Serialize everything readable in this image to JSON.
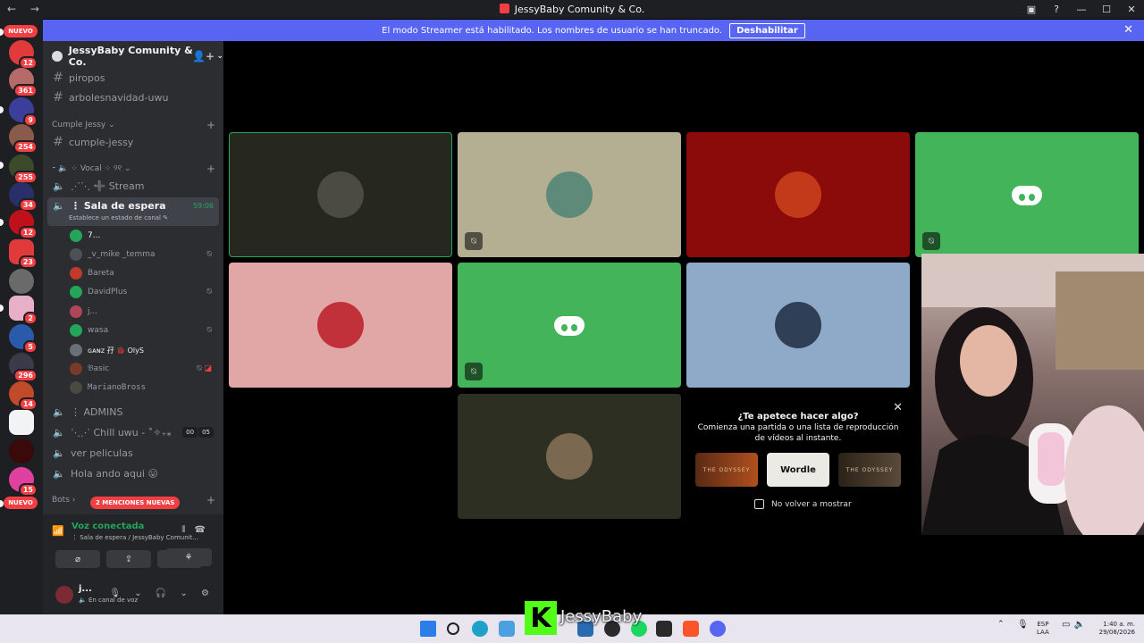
{
  "window": {
    "title": "JessyBaby Comunity & Co.",
    "nav": "← →",
    "buttons": [
      "▣",
      "?",
      "—",
      "☐",
      "✕"
    ]
  },
  "banner": {
    "text": "El modo Streamer está habilitado. Los nombres de usuario se han truncado.",
    "button": "Deshabilitar",
    "close": "✕"
  },
  "server_rail": {
    "nuevo_top": "NUEVO",
    "nuevo_bottom": "NUEVO",
    "counts": [
      "12",
      "361",
      "9",
      "254",
      "255",
      "34",
      "12",
      "23",
      "2",
      "5",
      "296",
      "14",
      "15",
      "124"
    ]
  },
  "guild": {
    "name": "JessyBaby Comunity & Co.",
    "chevron": "⌄",
    "invite": "👤+"
  },
  "channels": {
    "piropos": "piropos",
    "arboles": "arbolesnavidad-uwu",
    "cat_cumple": "Cumple Jessy",
    "cumple": "cumple-jessy",
    "cat_vocal": "⁃ 🔈 ⁘ Vocal ⁘ ୨୧ ⌄",
    "stream": "⋰⋱ ➕ Stream",
    "sala": "⋮ Sala de espera",
    "sala_sub": "Establece un estado de canal ✎",
    "sala_timer": "59:06",
    "admins": "⋮ ADMINS",
    "chill": "⋱⋰ Chill uwu - ˚✧₊⁎",
    "chill_pills": [
      "00",
      "05"
    ],
    "peliculas": "ver peliculas",
    "hola": "Hola ando aqui 😛",
    "cat_bots": "Bots ›",
    "mentions": "2 MENCIONES NUEVAS",
    "plus": "+"
  },
  "voice_users": [
    {
      "name": "7...",
      "muted": false,
      "color": "#23a55a"
    },
    {
      "name": "_v_mike _temma",
      "muted": true,
      "color": "#4e5058"
    },
    {
      "name": "Bareta",
      "muted": false,
      "color": "#c0392b"
    },
    {
      "name": "DavidPlus",
      "muted": true,
      "color": "#23a55a"
    },
    {
      "name": "j...",
      "muted": false,
      "color": "#b0455a"
    },
    {
      "name": "wasa",
      "muted": true,
      "color": "#23a55a"
    },
    {
      "name": "ɢᴀɴᴢ 孖  🐞 OlyS",
      "muted": false,
      "color": "#6a6f78"
    },
    {
      "name": "𝔅asic",
      "muted": true,
      "color": "#7a3a2a"
    },
    {
      "name": "MarianoBross",
      "muted": false,
      "color": "#4a4a40"
    }
  ],
  "voice_panel": {
    "status": "Voz conectada",
    "channel": "⋮ Sala de espera / JessyBaby Comunit...",
    "buttons": [
      "⌀",
      "⇪",
      "✦",
      "⚘"
    ]
  },
  "user": {
    "name": "j...",
    "status": "🔈 En canal de voz",
    "controls": "🎙 ⌄ 🎧 ⌄ ⚙"
  },
  "tiles": [
    {
      "bg": "#26271f",
      "border": "#23a55a",
      "avatar": "#4b4b42",
      "muted": false
    },
    {
      "bg": "#b4ae93",
      "avatar": "#5e8a7a",
      "muted": true
    },
    {
      "bg": "#8b0a0a",
      "avatar": "#c23a1a",
      "muted": false
    },
    {
      "bg": "#43b45a",
      "discord": true,
      "muted": true
    },
    {
      "bg": "#e0a7a6",
      "avatar": "#c0313a",
      "muted": false
    },
    {
      "bg": "#43b45a",
      "discord": true,
      "muted": true
    },
    {
      "bg": "#8faac9",
      "avatar": "#2f3f55",
      "muted": false
    },
    {
      "bg": "#2d2f23",
      "avatar": "#7a6850",
      "muted": false
    }
  ],
  "activity": {
    "title": "¿Te apetece hacer algo?",
    "line2": "Comienza una partida o una lista de reproducción",
    "line3": "de vídeos al instante.",
    "cards": [
      "THE ODYSSEY",
      "Wordle",
      "THE ODYSSEY"
    ],
    "no_show": "No volver a mostrar",
    "close": "✕"
  },
  "overlay": {
    "kick": "K",
    "name": "JessyBaby"
  },
  "taskbar": {
    "lang1": "ESP",
    "lang2": "LAA",
    "time": "1:40 a. m.",
    "date": "29/08/2026"
  }
}
